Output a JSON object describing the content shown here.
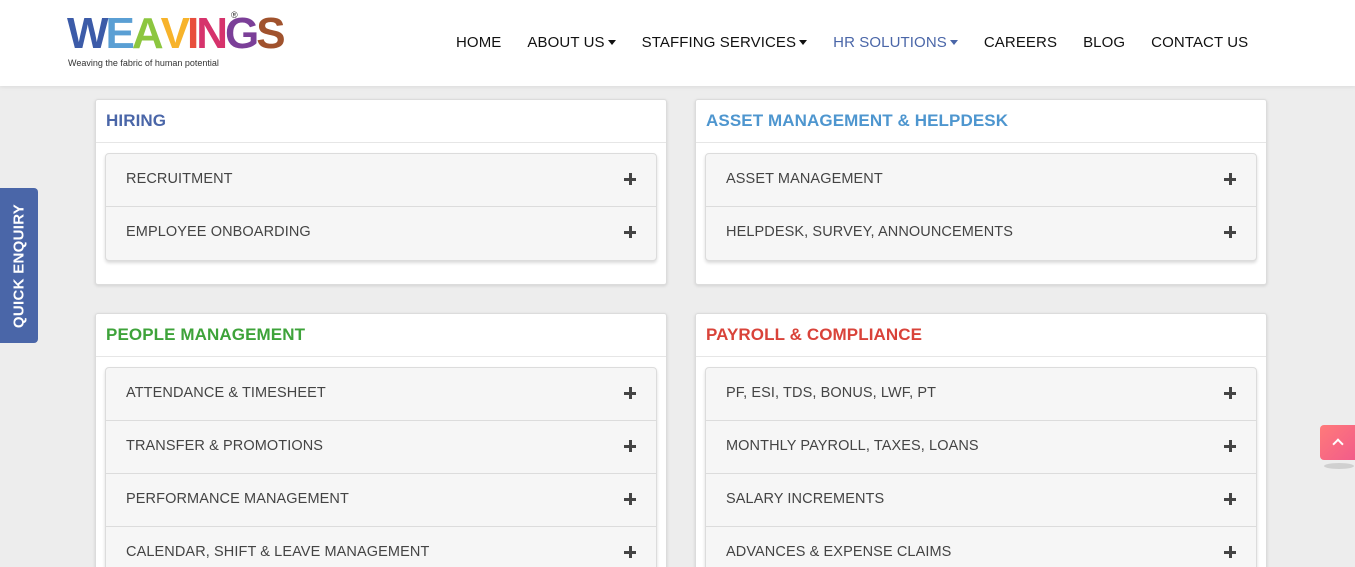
{
  "logo": {
    "letters": [
      {
        "char": "W",
        "color": "#3c5ba8"
      },
      {
        "char": "E",
        "color": "#5a9fd4"
      },
      {
        "char": "A",
        "color": "#8cc63f"
      },
      {
        "char": "V",
        "color": "#f7b32b"
      },
      {
        "char": "I",
        "color": "#e84e3c"
      },
      {
        "char": "N",
        "color": "#d6336c"
      },
      {
        "char": "G",
        "color": "#7b3f98"
      },
      {
        "char": "S",
        "color": "#a0522d"
      }
    ],
    "reg": "®",
    "tagline": "Weaving the fabric of human potential"
  },
  "nav": {
    "items": [
      {
        "label": "HOME",
        "dropdown": false,
        "active": false
      },
      {
        "label": "ABOUT US",
        "dropdown": true,
        "active": false
      },
      {
        "label": "STAFFING SERVICES",
        "dropdown": true,
        "active": false
      },
      {
        "label": "HR SOLUTIONS",
        "dropdown": true,
        "active": true
      },
      {
        "label": "CAREERS",
        "dropdown": false,
        "active": false
      },
      {
        "label": "BLOG",
        "dropdown": false,
        "active": false
      },
      {
        "label": "CONTACT US",
        "dropdown": false,
        "active": false
      }
    ]
  },
  "sections": {
    "hiring": {
      "title": "HIRING",
      "color": "#4a66a8",
      "items": [
        "RECRUITMENT",
        "EMPLOYEE ONBOARDING"
      ]
    },
    "asset": {
      "title": "ASSET MANAGEMENT & HELPDESK",
      "color": "#4e96cf",
      "items": [
        "ASSET MANAGEMENT",
        "HELPDESK, SURVEY, ANNOUNCEMENTS"
      ]
    },
    "people": {
      "title": "PEOPLE MANAGEMENT",
      "color": "#3ea33a",
      "items": [
        "ATTENDANCE & TIMESHEET",
        "TRANSFER & PROMOTIONS",
        "PERFORMANCE MANAGEMENT",
        "CALENDAR, SHIFT & LEAVE MANAGEMENT"
      ]
    },
    "payroll": {
      "title": "PAYROLL & COMPLIANCE",
      "color": "#d9433a",
      "items": [
        "PF, ESI, TDS, BONUS, LWF, PT",
        "MONTHLY PAYROLL, TAXES, LOANS",
        "SALARY INCREMENTS",
        "ADVANCES & EXPENSE CLAIMS"
      ]
    }
  },
  "quick_enquiry": {
    "label": "QUICK ENQUIRY",
    "color": "#4a66a8"
  }
}
